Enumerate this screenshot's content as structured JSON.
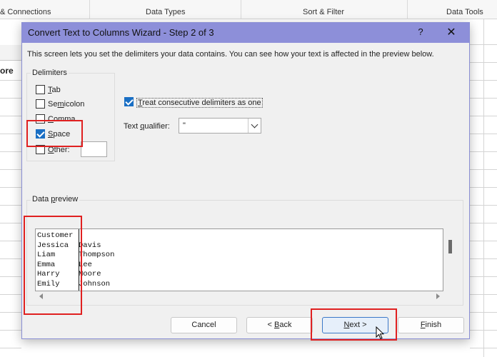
{
  "ribbon": {
    "groups": [
      "& Connections",
      "Data Types",
      "Sort & Filter",
      "Data Tools"
    ]
  },
  "sheet": {
    "partial_header": "ore"
  },
  "dialog": {
    "title": "Convert Text to Columns Wizard - Step 2 of 3",
    "help_label": "?",
    "close_label": "✕",
    "intro": "This screen lets you set the delimiters your data contains.  You can see how your text is affected in the preview below.",
    "delimiters": {
      "label": "Delimiters",
      "tab": {
        "accel": "T",
        "rest": "ab",
        "checked": false
      },
      "semicolon": {
        "pre": "Se",
        "accel": "m",
        "rest": "icolon",
        "checked": false
      },
      "comma": {
        "accel": "C",
        "rest": "omma",
        "checked": false
      },
      "space": {
        "accel": "S",
        "rest": "pace",
        "checked": true
      },
      "other": {
        "accel": "O",
        "rest": "ther:",
        "checked": false,
        "value": ""
      }
    },
    "consecutive": {
      "accel": "T",
      "rest": "reat consecutive delimiters as one",
      "checked": true
    },
    "text_qualifier": {
      "pre": "Text ",
      "accel": "q",
      "rest": "ualifier:",
      "value": "\""
    },
    "preview": {
      "label_pre": "Data ",
      "label_accel": "p",
      "label_rest": "review",
      "rows": [
        {
          "c1": "Customer",
          "c2": ""
        },
        {
          "c1": "Jessica",
          "c2": "Davis"
        },
        {
          "c1": "Liam",
          "c2": "Thompson"
        },
        {
          "c1": "Emma",
          "c2": "Lee"
        },
        {
          "c1": "Harry",
          "c2": "Moore"
        },
        {
          "c1": "Emily",
          "c2": "Johnson"
        }
      ]
    },
    "buttons": {
      "cancel": "Cancel",
      "back": "< Back",
      "back_pre": "< ",
      "back_accel": "B",
      "back_rest": "ack",
      "next_accel": "N",
      "next_rest": "ext >",
      "finish_accel": "F",
      "finish_rest": "inish"
    }
  },
  "colors": {
    "titlebar": "#8d8fd9",
    "checkbox_checked": "#1a6fc4",
    "highlight": "#e02020",
    "primary_button_border": "#3b78c8"
  }
}
